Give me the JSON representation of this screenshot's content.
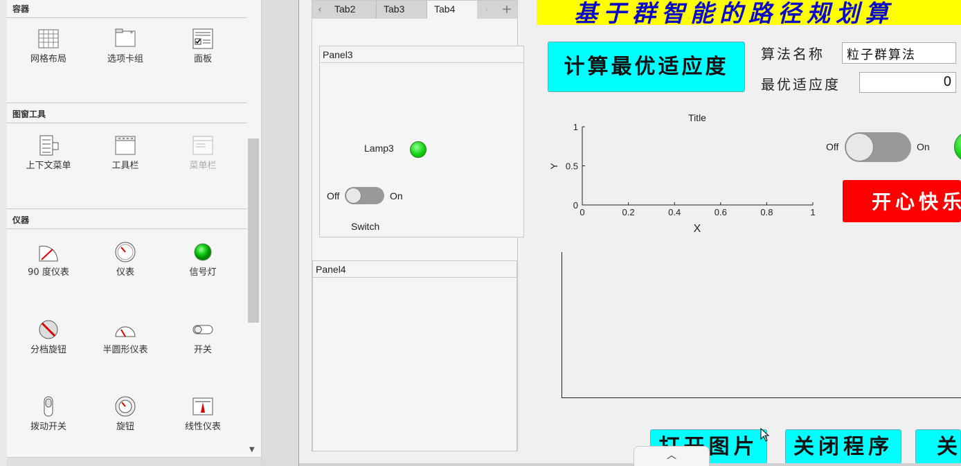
{
  "library": {
    "sections": [
      {
        "header": "容器",
        "items": [
          {
            "label": "网格布局",
            "icon": "grid-layout-icon"
          },
          {
            "label": "选项卡组",
            "icon": "tab-group-icon"
          },
          {
            "label": "面板",
            "icon": "panel-icon"
          }
        ]
      },
      {
        "header": "图窗工具",
        "items": [
          {
            "label": "上下文菜单",
            "icon": "context-menu-icon"
          },
          {
            "label": "工具栏",
            "icon": "toolbar-icon"
          },
          {
            "label": "菜单栏",
            "icon": "menubar-icon",
            "disabled": true
          }
        ]
      },
      {
        "header": "仪器",
        "items": [
          {
            "label": "90 度仪表",
            "icon": "ninety-degree-gauge-icon"
          },
          {
            "label": "仪表",
            "icon": "gauge-icon"
          },
          {
            "label": "信号灯",
            "icon": "lamp-icon"
          },
          {
            "label": "分档旋钮",
            "icon": "discrete-knob-icon"
          },
          {
            "label": "半圆形仪表",
            "icon": "semicircular-gauge-icon"
          },
          {
            "label": "开关",
            "icon": "switch-icon"
          },
          {
            "label": "拨动开关",
            "icon": "toggle-switch-icon"
          },
          {
            "label": "旋钮",
            "icon": "knob-icon"
          },
          {
            "label": "线性仪表",
            "icon": "linear-gauge-icon"
          }
        ]
      }
    ]
  },
  "tabgroup": {
    "prev": "‹",
    "next": "›",
    "add": "+",
    "tabs": [
      {
        "label": "Tab2",
        "active": false
      },
      {
        "label": "Tab3",
        "active": false
      },
      {
        "label": "Tab4",
        "active": true
      }
    ],
    "panel3": {
      "title": "Panel3",
      "lamp_label": "Lamp3",
      "switch_off": "Off",
      "switch_on": "On",
      "switch_label": "Switch"
    },
    "panel4": {
      "title": "Panel4"
    }
  },
  "app": {
    "title": "基于群智能的路径规划算",
    "compute_button": "计算最优适应度",
    "algo_name_label": "算法名称",
    "algo_name_value": "粒子群算法",
    "best_fitness_label": "最优适应度",
    "best_fitness_value": "0",
    "switch_off": "Off",
    "switch_on": "On",
    "red_button": "开心快乐",
    "open_image_button": "打开图片",
    "close_program_button": "关闭程序",
    "third_button": "关"
  },
  "colors": {
    "title_band": "#ffff00",
    "title_text": "#0a0ac8",
    "cyan": "#00ffff",
    "red": "#ff0000",
    "lamp": "#11d211"
  },
  "chart_data": {
    "type": "line",
    "title": "Title",
    "xlabel": "X",
    "ylabel": "Y",
    "xlim": [
      0,
      1
    ],
    "ylim": [
      0,
      1
    ],
    "xticks": [
      "0",
      "0.2",
      "0.4",
      "0.6",
      "0.8",
      "1"
    ],
    "yticks": [
      "0",
      "0.5",
      "1"
    ],
    "series": []
  }
}
